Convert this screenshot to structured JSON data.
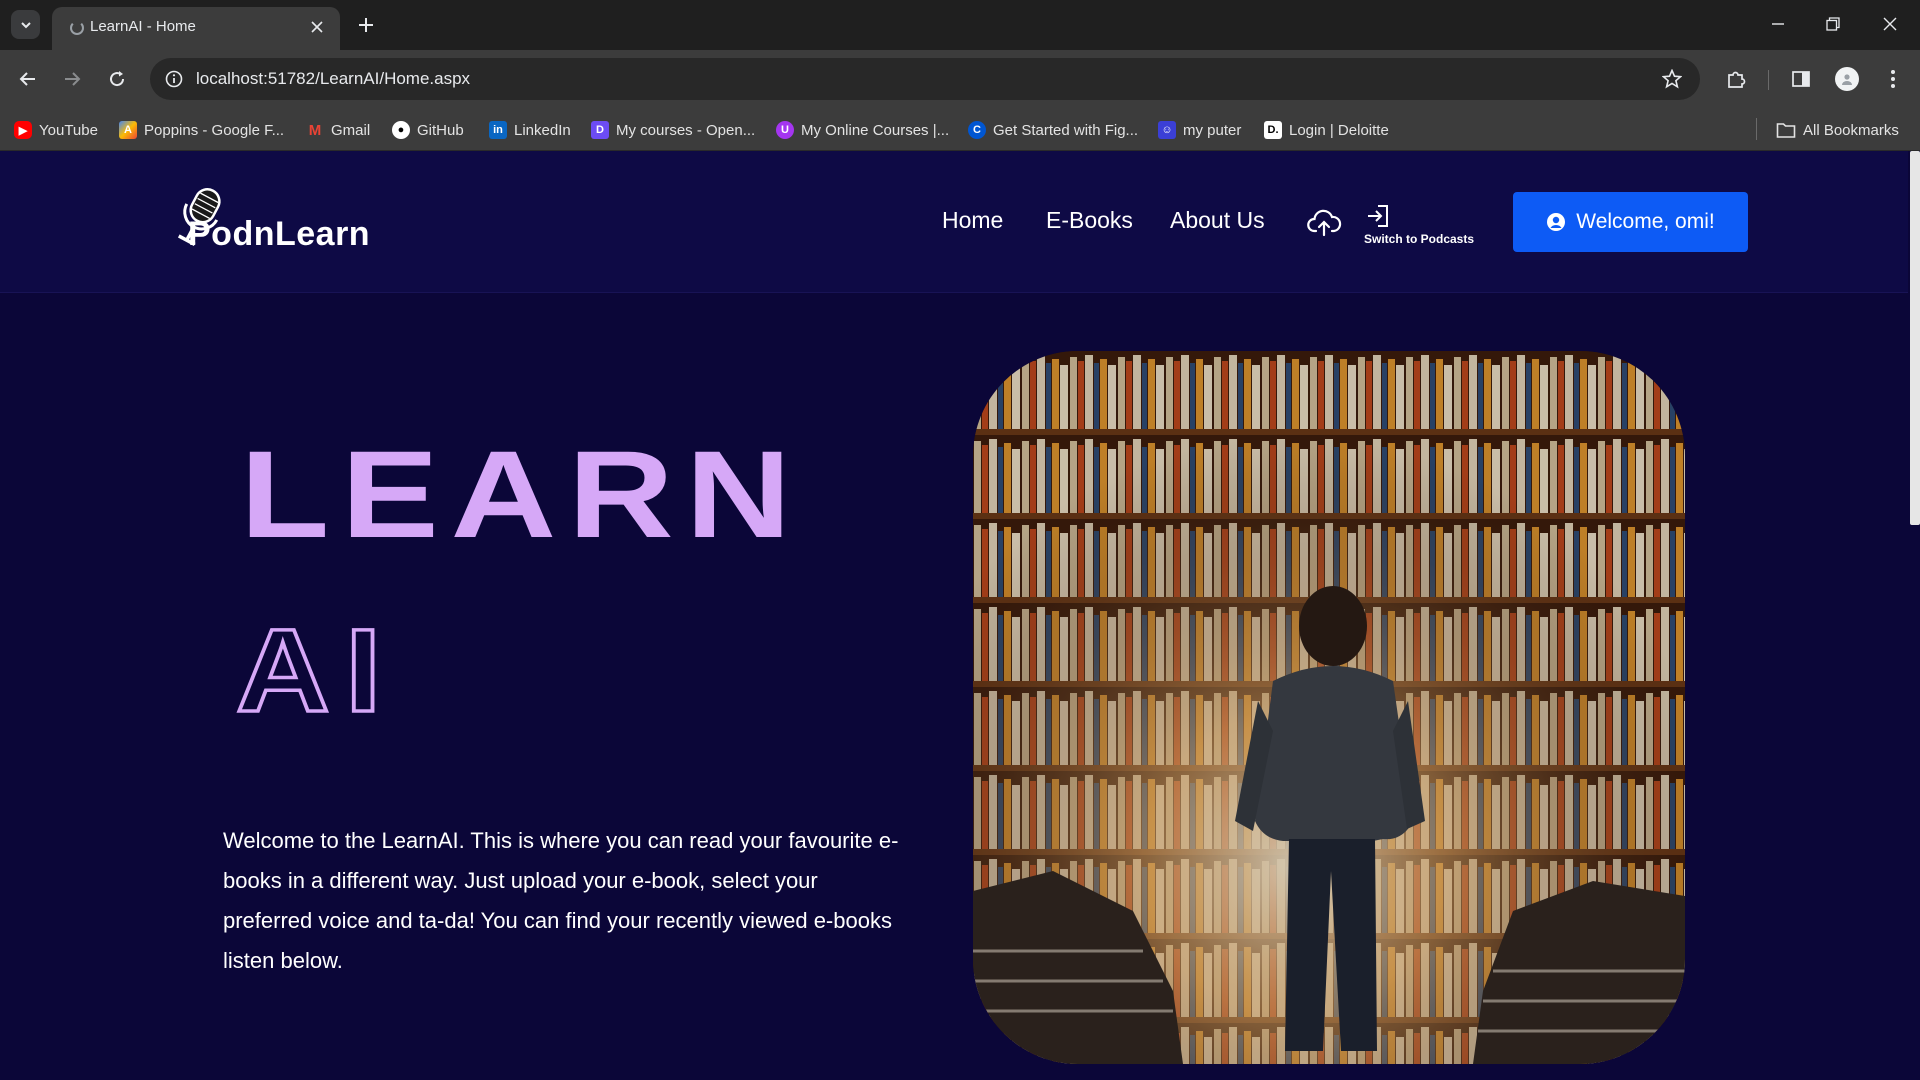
{
  "browser": {
    "tab_title": "LearnAI - Home",
    "url": "localhost:51782/LearnAI/Home.aspx",
    "bookmarks": [
      {
        "label": "YouTube",
        "icon": "youtube-icon",
        "color": "#ff0000"
      },
      {
        "label": "Poppins - Google F...",
        "icon": "google-fonts-icon",
        "color": "#4285f4"
      },
      {
        "label": "Gmail",
        "icon": "gmail-icon",
        "color": "#ea4335"
      },
      {
        "label": "GitHub",
        "icon": "github-icon",
        "color": "#ffffff"
      },
      {
        "label": "LinkedIn",
        "icon": "linkedin-icon",
        "color": "#0a66c2"
      },
      {
        "label": "My courses - Open...",
        "icon": "courses-icon",
        "color": "#6c4cf5"
      },
      {
        "label": "My Online Courses |...",
        "icon": "udemy-icon",
        "color": "#a435f0"
      },
      {
        "label": "Get Started with Fig...",
        "icon": "coursera-icon",
        "color": "#0056d2"
      },
      {
        "label": "my puter",
        "icon": "puter-icon",
        "color": "#3b3fd6"
      },
      {
        "label": "Login | Deloitte",
        "icon": "deloitte-icon",
        "color": "#ffffff"
      }
    ],
    "all_bookmarks": "All Bookmarks"
  },
  "site": {
    "logo_text": "PodnLearn",
    "nav": {
      "home": "Home",
      "ebooks": "E-Books",
      "about": "About Us",
      "switch_label": "Switch to Podcasts"
    },
    "welcome": "Welcome, omi!"
  },
  "hero": {
    "line1": "LEARN",
    "line2": "AI",
    "intro": "Welcome to the LearnAI. This is where you can read your favourite e-books in a different way. Just upload your e-book, select your preferred voice and ta-da! You can find your recently viewed e-books listen below.",
    "image_description_icon": "library-boy-image",
    "accent_color": "#d6a8f7",
    "button_color": "#0d5bf5"
  }
}
